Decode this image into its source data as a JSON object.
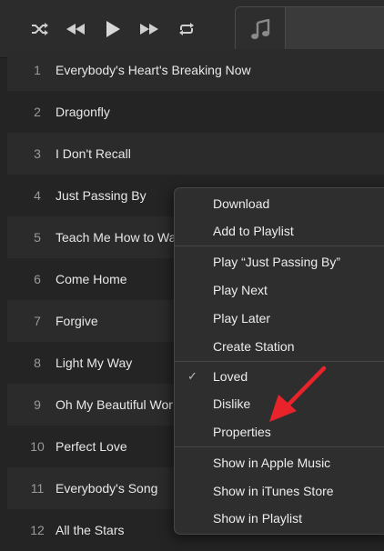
{
  "toolbar": {
    "shuffle_icon": "shuffle-icon",
    "previous_icon": "rewind-icon",
    "play_icon": "play-icon",
    "next_icon": "fast-forward-icon",
    "repeat_icon": "repeat-icon",
    "lcd_icon": "music-note-icon"
  },
  "tracks": [
    {
      "num": "1",
      "title": "Everybody's Heart's Breaking Now"
    },
    {
      "num": "2",
      "title": "Dragonfly"
    },
    {
      "num": "3",
      "title": "I Don't Recall"
    },
    {
      "num": "4",
      "title": "Just Passing By"
    },
    {
      "num": "5",
      "title": "Teach Me How to Wa"
    },
    {
      "num": "6",
      "title": "Come Home"
    },
    {
      "num": "7",
      "title": "Forgive"
    },
    {
      "num": "8",
      "title": "Light My Way"
    },
    {
      "num": "9",
      "title": "Oh My Beautiful Wor"
    },
    {
      "num": "10",
      "title": "Perfect Love"
    },
    {
      "num": "11",
      "title": "Everybody's Song"
    },
    {
      "num": "12",
      "title": "All the Stars"
    }
  ],
  "context_menu": {
    "download": "Download",
    "add_to_playlist": "Add to Playlist",
    "play_song": "Play “Just Passing By”",
    "play_next": "Play Next",
    "play_later": "Play Later",
    "create_station": "Create Station",
    "loved": "Loved",
    "loved_check": "✓",
    "dislike": "Dislike",
    "properties": "Properties",
    "show_apple_music": "Show in Apple Music",
    "show_itunes_store": "Show in iTunes Store",
    "show_in_playlist": "Show in Playlist"
  },
  "colors": {
    "background": "#242424",
    "menu_background": "#2e2e2e",
    "annotation_arrow": "#e8232a"
  }
}
